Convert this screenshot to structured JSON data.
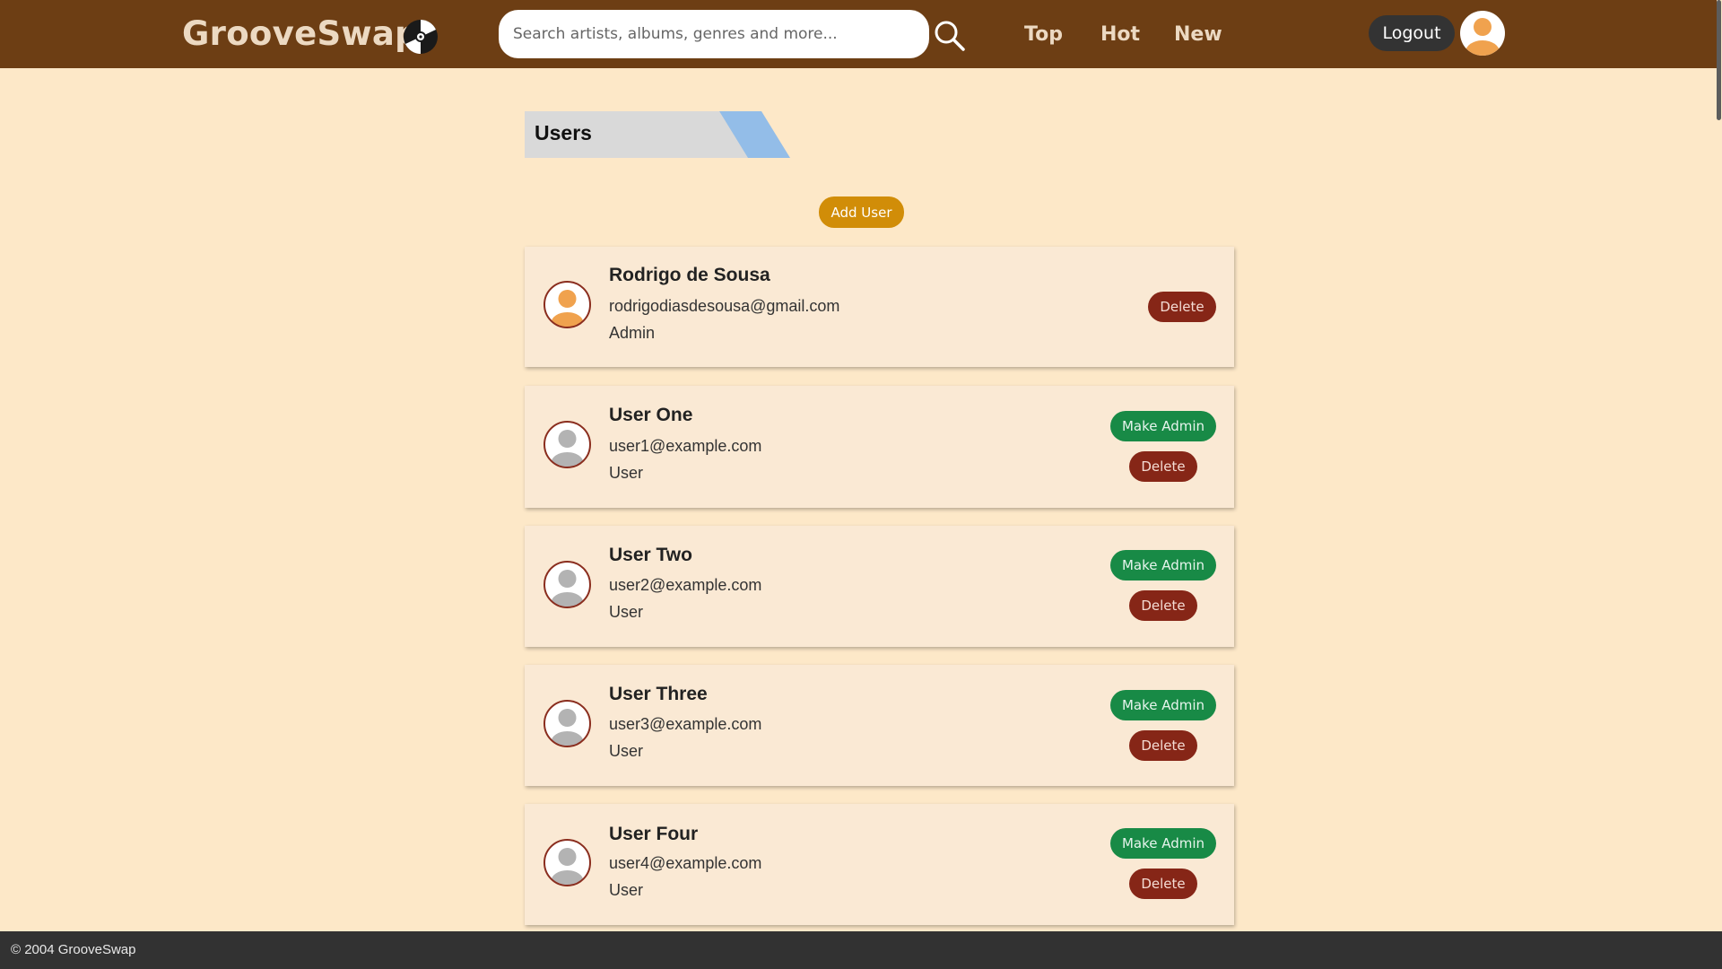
{
  "app": {
    "brand": "GrooveSwap",
    "logo_icon": "vinyl-record-icon"
  },
  "header": {
    "search_placeholder": "Search artists, albums, genres and more...",
    "search_value": "",
    "search_icon": "search-icon",
    "nav": [
      "Top",
      "Hot",
      "New"
    ],
    "logout_label": "Logout",
    "avatar_icon": "user-avatar-icon"
  },
  "page": {
    "title": "Users",
    "add_user_label": "Add User"
  },
  "users": [
    {
      "name": "Rodrigo de Sousa",
      "email": "rodrigodiasdesousa@gmail.com",
      "role": "Admin",
      "make_admin_label": "",
      "delete_label": "Delete"
    },
    {
      "name": "User One",
      "email": "user1@example.com",
      "role": "User",
      "make_admin_label": "Make Admin",
      "delete_label": "Delete"
    },
    {
      "name": "User Two",
      "email": "user2@example.com",
      "role": "User",
      "make_admin_label": "Make Admin",
      "delete_label": "Delete"
    },
    {
      "name": "User Three",
      "email": "user3@example.com",
      "role": "User",
      "make_admin_label": "Make Admin",
      "delete_label": "Delete"
    },
    {
      "name": "User Four",
      "email": "user4@example.com",
      "role": "User",
      "make_admin_label": "Make Admin",
      "delete_label": "Delete"
    }
  ],
  "footer": {
    "text": "© 2004 GrooveSwap"
  },
  "colors": {
    "topbar": "#6d3e14",
    "page_bg": "#fde8c8",
    "card_bg": "#fae9d4",
    "make_admin": "#188a46",
    "delete": "#862617",
    "add_user": "#d18d08",
    "admin_avatar": "#f0a24e",
    "user_avatar": "#b3b3b3",
    "avatar_border": "#8a2d1e"
  }
}
